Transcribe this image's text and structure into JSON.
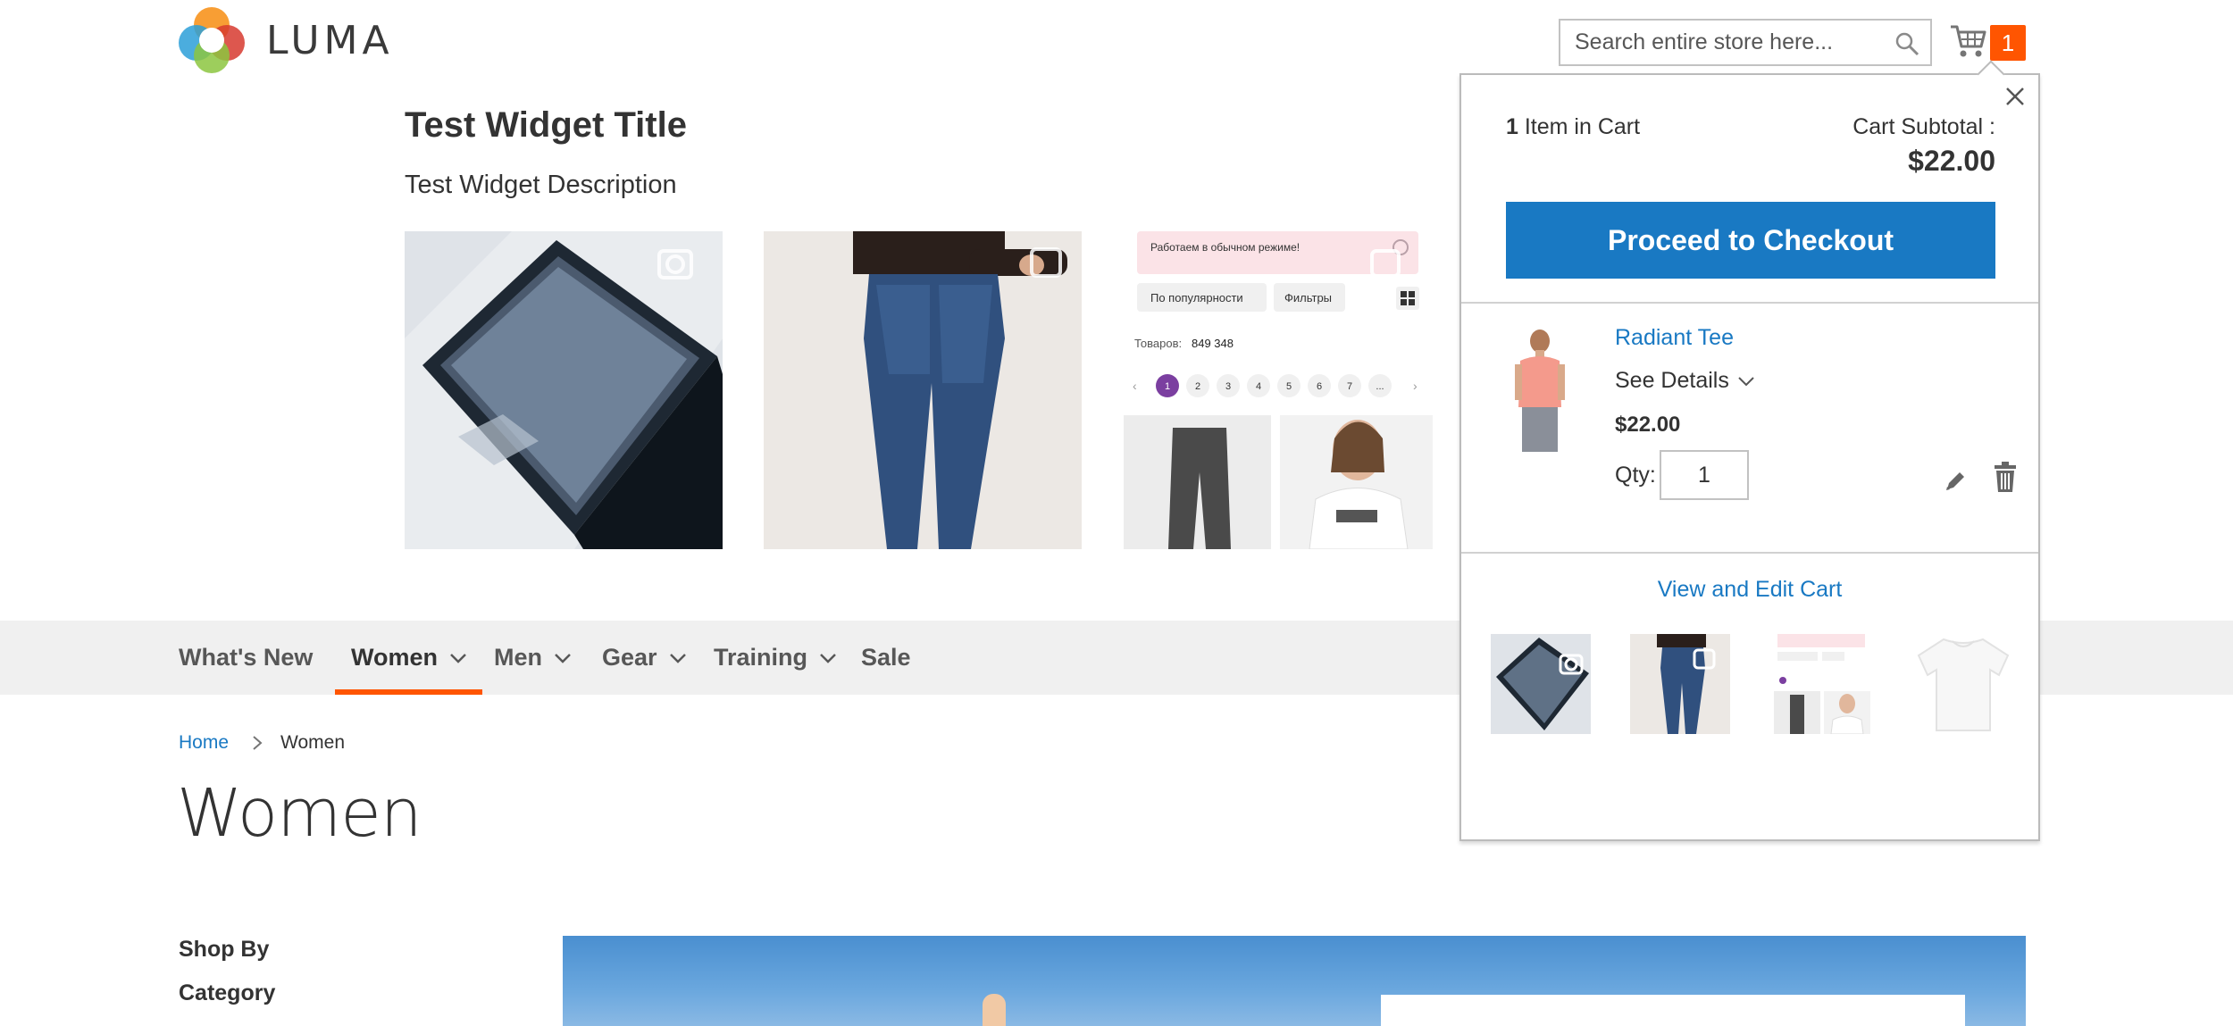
{
  "header": {
    "logo_text": "LUMA",
    "search_placeholder": "Search entire store here...",
    "cart_count": "1",
    "icons": [
      "search-icon",
      "cart-icon"
    ]
  },
  "widget": {
    "title": "Test Widget Title",
    "description": "Test Widget Description",
    "screenshot_tile": {
      "banner": "Работаем в обычном режиме!",
      "filter_1": "По популярности",
      "filter_2": "Фильтры",
      "count_label": "Товаров:",
      "count_value": "849 348",
      "pages": [
        "1",
        "2",
        "3",
        "4",
        "5",
        "6",
        "7",
        "..."
      ]
    }
  },
  "nav": {
    "items": [
      {
        "label": "What's New",
        "has_dropdown": false
      },
      {
        "label": "Women",
        "has_dropdown": true,
        "active": true
      },
      {
        "label": "Men",
        "has_dropdown": true
      },
      {
        "label": "Gear",
        "has_dropdown": true
      },
      {
        "label": "Training",
        "has_dropdown": true
      },
      {
        "label": "Sale",
        "has_dropdown": false
      }
    ]
  },
  "breadcrumbs": {
    "home": "Home",
    "current": "Women"
  },
  "page": {
    "title": "Women",
    "shop_by": "Shop By",
    "category": "Category"
  },
  "minicart": {
    "count_number": "1",
    "count_text": "Item in Cart",
    "subtotal_label": "Cart Subtotal :",
    "subtotal_value": "$22.00",
    "checkout_label": "Proceed to Checkout",
    "item": {
      "name": "Radiant Tee",
      "details_label": "See Details",
      "price": "$22.00",
      "qty_label": "Qty:",
      "qty_value": "1"
    },
    "view_edit_label": "View and Edit Cart"
  },
  "colors": {
    "accent": "#1979c3",
    "counter": "#ff5501",
    "nav_bg": "#f0f0f0",
    "nav_active_border": "#ff5501"
  }
}
